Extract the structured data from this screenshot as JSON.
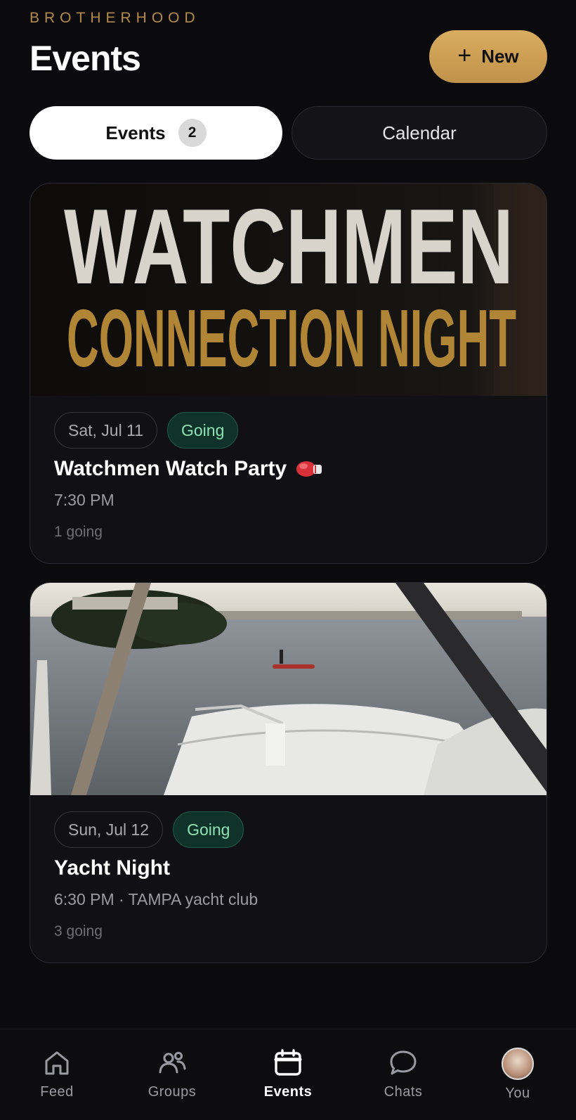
{
  "header": {
    "brand": "BROTHERHOOD",
    "title": "Events",
    "new_button_label": "New",
    "new_button_icon": "plus-icon"
  },
  "segments": {
    "events_label": "Events",
    "events_count": "2",
    "calendar_label": "Calendar",
    "selected": "Events"
  },
  "events": [
    {
      "cover_line1": "WATCHMEN",
      "cover_line2": "CONNECTION NIGHT",
      "date": "Sat, Jul 11",
      "status": "Going",
      "title": "Watchmen Watch Party",
      "title_emoji": "boxing-glove-icon",
      "meta": "7:30 PM",
      "going": "1 going"
    },
    {
      "cover_image": "yacht-bow-harbor-photo",
      "date": "Sun, Jul 12",
      "status": "Going",
      "title": "Yacht Night",
      "meta": "6:30 PM · TAMPA yacht club",
      "going": "3 going"
    }
  ],
  "tabbar": {
    "items": [
      {
        "label": "Feed",
        "icon": "home-icon"
      },
      {
        "label": "Groups",
        "icon": "people-icon"
      },
      {
        "label": "Events",
        "icon": "calendar-icon",
        "active": true
      },
      {
        "label": "Chats",
        "icon": "chat-bubble-icon"
      },
      {
        "label": "You",
        "icon": "avatar"
      }
    ]
  },
  "colors": {
    "background": "#0b0b0d",
    "accent_gold": "#c9a052",
    "going_text": "#8fe0b4",
    "going_bg": "#0f3328"
  }
}
